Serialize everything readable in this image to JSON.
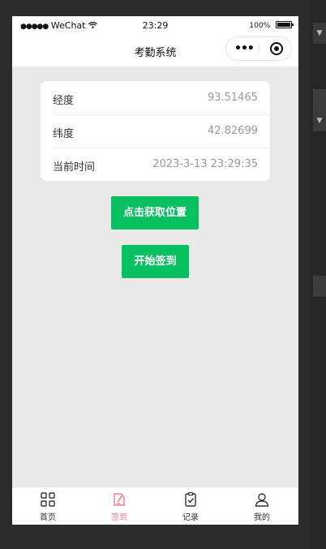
{
  "status_bar": {
    "carrier": "WeChat",
    "time": "23:29",
    "battery": "100%"
  },
  "nav": {
    "title": "考勤系统",
    "menu_icon": "more-dots-icon",
    "close_icon": "target-icon"
  },
  "location_card": {
    "rows": [
      {
        "label": "经度",
        "value": "93.51465"
      },
      {
        "label": "纬度",
        "value": "42.82699"
      },
      {
        "label": "当前时间",
        "value": "2023-3-13 23:29:35"
      }
    ]
  },
  "actions": {
    "get_location": "点击获取位置",
    "start_checkin": "开始签到"
  },
  "tabbar": {
    "tabs": [
      {
        "label": "首页",
        "icon": "grid-icon"
      },
      {
        "label": "签到",
        "icon": "edit-icon"
      },
      {
        "label": "记录",
        "icon": "clipboard-icon"
      },
      {
        "label": "我的",
        "icon": "user-icon"
      }
    ],
    "active_color": "#f07a8a"
  },
  "theme": {
    "primary": "#07c160"
  }
}
